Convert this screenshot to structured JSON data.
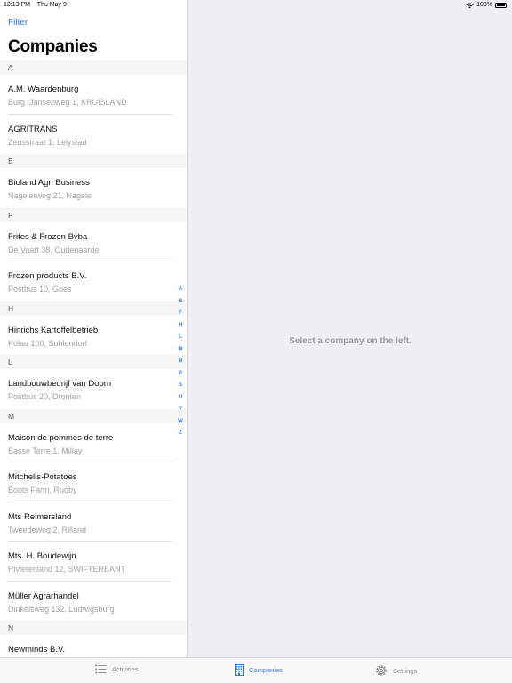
{
  "status_bar": {
    "time": "12:13 PM",
    "date": "Thu May 9",
    "battery": "100%"
  },
  "master": {
    "filter_label": "Filter",
    "title": "Companies",
    "sections": [
      {
        "letter": "A",
        "items": [
          {
            "name": "A.M. Waardenburg",
            "address": "Burg. Jansenweg 1, KRUISLAND"
          },
          {
            "name": "AGRITRANS",
            "address": "Zeusstraat 1, Lelystad"
          }
        ]
      },
      {
        "letter": "B",
        "items": [
          {
            "name": "Bioland Agri Business",
            "address": "Nagelerweg 21, Nagele"
          }
        ]
      },
      {
        "letter": "F",
        "items": [
          {
            "name": "Frites & Frozen Bvba",
            "address": "De Vaart 38, Oudenaarde"
          },
          {
            "name": "Frozen products B.V.",
            "address": "Postbus 10, Goes"
          }
        ]
      },
      {
        "letter": "H",
        "items": [
          {
            "name": "Hinrichs Kartoffelbetrieb",
            "address": "Kölau 100, Suhlendorf"
          }
        ]
      },
      {
        "letter": "L",
        "items": [
          {
            "name": "Landbouwbedrijf van Doorn",
            "address": "Postbus 20, Dronten"
          }
        ]
      },
      {
        "letter": "M",
        "items": [
          {
            "name": "Maison de pommes de terre",
            "address": "Basse Terre 1, Millay"
          },
          {
            "name": "Mitchells-Potatoes",
            "address": "Boots Farm, Rugby"
          },
          {
            "name": "Mts Reimersland",
            "address": "Tweedeweg 2, Rilland"
          },
          {
            "name": "Mts. H. Boudewijn",
            "address": "Rivierenland 12, SWIFTERBANT"
          },
          {
            "name": "Müller Agrarhandel",
            "address": "Dinkelsweg 132, Ludwigsburg"
          }
        ]
      },
      {
        "letter": "N",
        "items": [
          {
            "name": "Newminds B.V.",
            "address": ""
          }
        ]
      }
    ],
    "index_letters": [
      "A",
      "B",
      "F",
      "H",
      "L",
      "M",
      "N",
      "P",
      "S",
      "U",
      "V",
      "W",
      "Z"
    ]
  },
  "detail": {
    "placeholder": "Select a company on the left."
  },
  "tabs": [
    {
      "label": "Activities",
      "icon": "list-icon",
      "active": false
    },
    {
      "label": "Companies",
      "icon": "building-icon",
      "active": true
    },
    {
      "label": "Settings",
      "icon": "gear-icon",
      "active": false
    }
  ],
  "colors": {
    "accent": "#2f7bf6",
    "secondary_text": "#a3a3a6",
    "detail_background": "#efeff4"
  }
}
